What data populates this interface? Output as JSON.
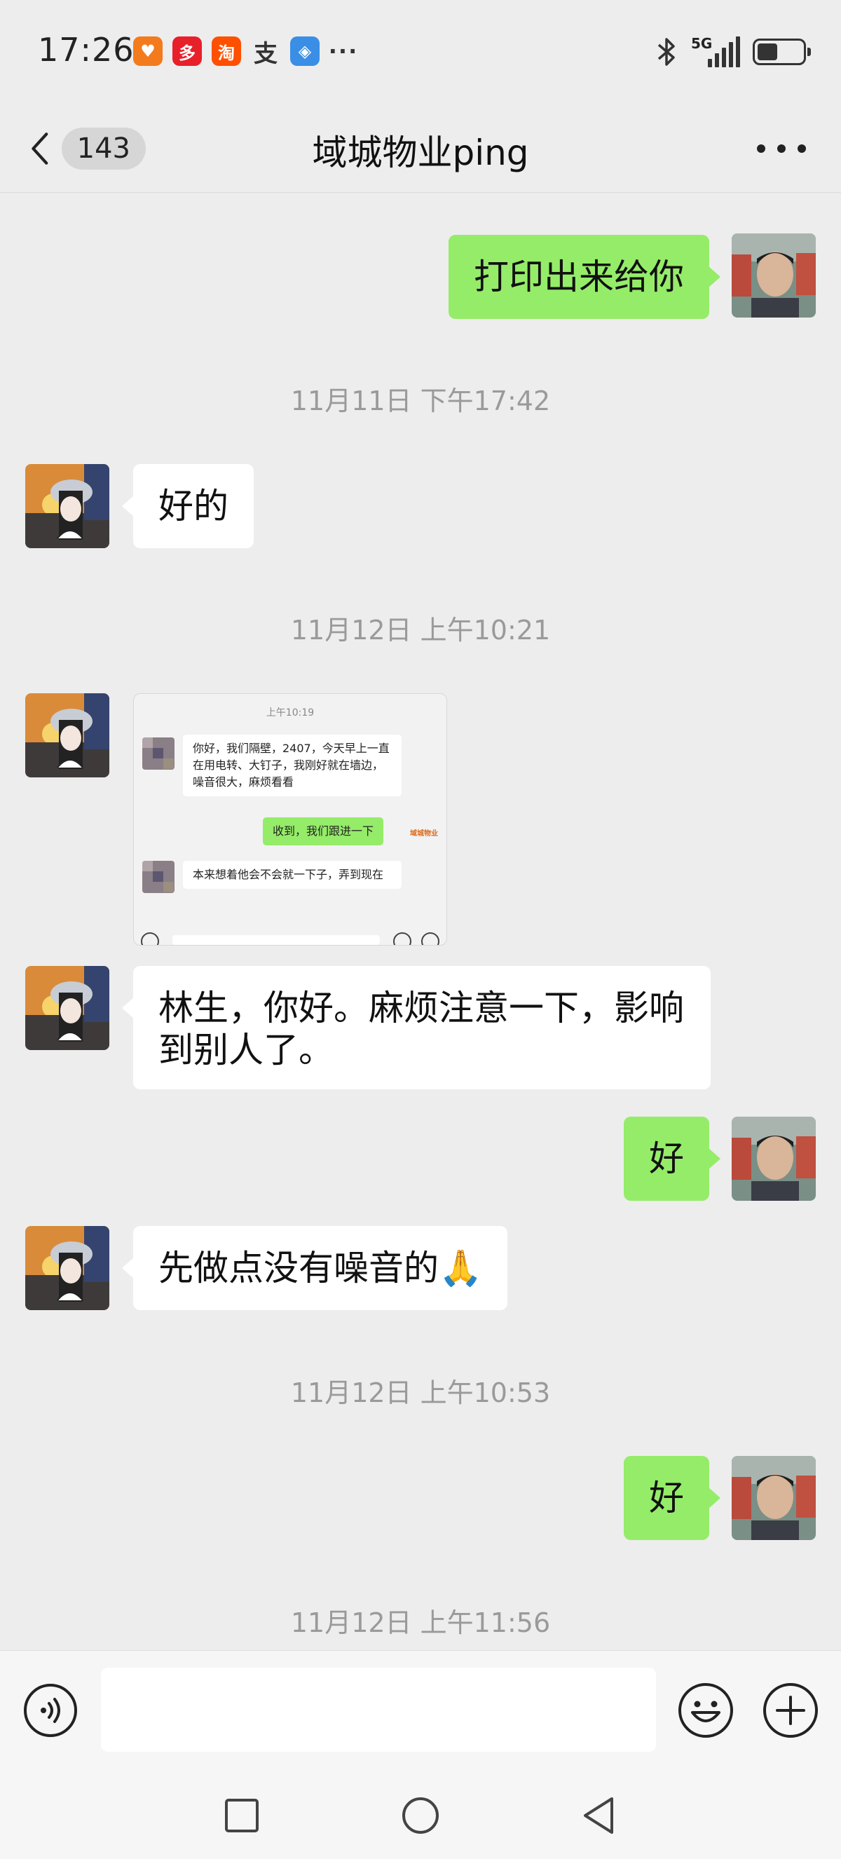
{
  "status_bar": {
    "time": "17:26",
    "network": "5G",
    "notification_icons": [
      {
        "name": "heart-app-icon",
        "glyph": "♥",
        "color": "#f37b1d"
      },
      {
        "name": "pinduoduo-app-icon",
        "glyph": "多",
        "color": "#e8202a"
      },
      {
        "name": "taobao-app-icon",
        "glyph": "淘",
        "color": "#ff4f00"
      },
      {
        "name": "alipay-app-icon",
        "glyph": "支",
        "color": "#333333"
      },
      {
        "name": "shield-app-icon",
        "glyph": "◈",
        "color": "#3a8ee6"
      }
    ],
    "more": "···"
  },
  "header": {
    "unread_count": "143",
    "title": "域城物业ping"
  },
  "messages": [
    {
      "id": "m1",
      "direction": "out",
      "text": "打印出来给你"
    },
    {
      "id": "t1",
      "type": "timestamp",
      "text": "11月11日 下午17:42"
    },
    {
      "id": "m2",
      "direction": "in",
      "text": "好的"
    },
    {
      "id": "t2",
      "type": "timestamp",
      "text": "11月12日 上午10:21"
    },
    {
      "id": "m3",
      "direction": "in",
      "type": "image",
      "screenshot": {
        "time": "上午10:19",
        "msg1": "你好，我们隔壁，2407，今天早上一直在用电转、大钉子，我刚好就在墙边，噪音很大，麻烦看看",
        "reply": "收到，我们跟进一下",
        "msg2": "本来想着他会不会就一下子，弄到现在",
        "logo": "域城物业"
      }
    },
    {
      "id": "m4",
      "direction": "in",
      "text": "林生，你好。麻烦注意一下，影响到别人了。"
    },
    {
      "id": "m5",
      "direction": "out",
      "text": "好"
    },
    {
      "id": "m6",
      "direction": "in",
      "text": "先做点没有噪音的🙏"
    },
    {
      "id": "t3",
      "type": "timestamp",
      "text": "11月12日 上午10:53"
    },
    {
      "id": "m7",
      "direction": "out",
      "text": "好"
    },
    {
      "id": "t4",
      "type": "timestamp",
      "text": "11月12日 上午11:56"
    }
  ],
  "input": {
    "placeholder": "",
    "value": ""
  },
  "colors": {
    "sent_bubble": "#95ec69",
    "received_bubble": "#ffffff",
    "background": "#ededed"
  }
}
